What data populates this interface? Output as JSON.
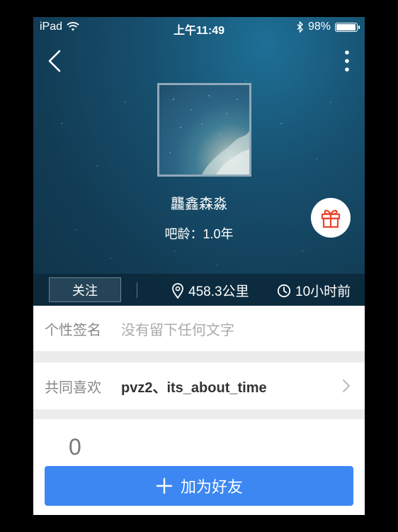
{
  "status_bar": {
    "device": "iPad",
    "time": "上午11:49",
    "battery_text": "98%",
    "battery_level": 0.98
  },
  "profile": {
    "username": "龘鑫森淼",
    "bar_age": "吧龄：1.0年"
  },
  "info_bar": {
    "follow_label": "关注",
    "distance": "458.3公里",
    "last_seen": "10小时前"
  },
  "signature": {
    "label": "个性签名",
    "value": "没有留下任何文字"
  },
  "common_likes": {
    "label": "共同喜欢",
    "value": "pvz2、its_about_time"
  },
  "count": "0",
  "add_friend_label": "加为好友",
  "colors": {
    "accent": "#3d87f2",
    "gift_red": "#e8462d"
  },
  "icons": {
    "back": "chevron-left-icon",
    "more": "more-vertical-icon",
    "gift": "gift-icon",
    "location": "location-pin-icon",
    "clock": "clock-icon",
    "plus": "plus-icon"
  }
}
